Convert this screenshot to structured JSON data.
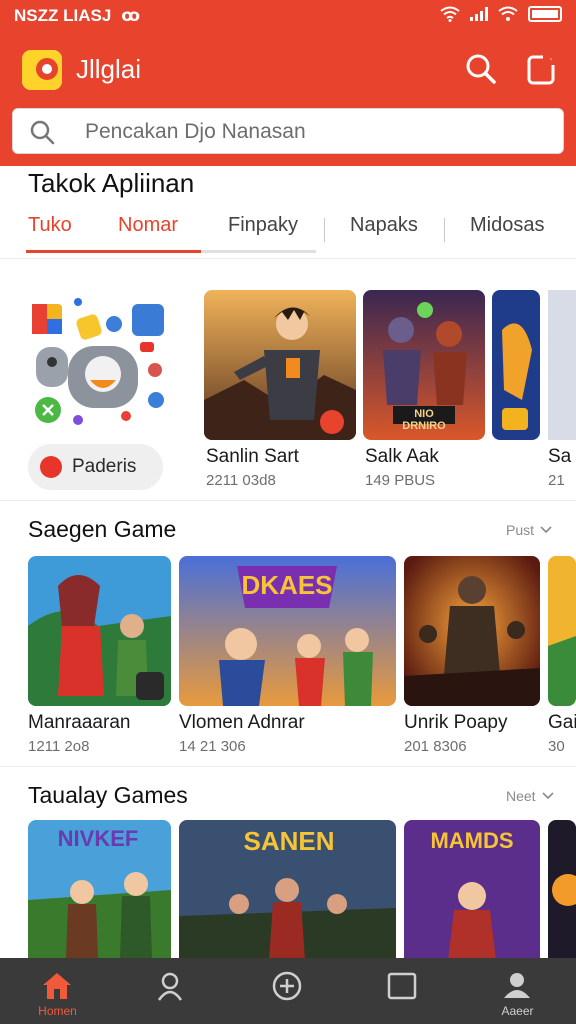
{
  "status": {
    "left_text": "NSZZ LIASJ",
    "carrier_glyph": "ꝏ"
  },
  "app": {
    "title": "Jllglai"
  },
  "search": {
    "placeholder": "Pencakan Djo Nanasan"
  },
  "section1": {
    "title": "Takok Apliinan",
    "tabs": [
      {
        "label": "Tuko"
      },
      {
        "label": "Nomar"
      },
      {
        "label": "Finpaky"
      },
      {
        "label": "Napaks"
      },
      {
        "label": "Midosas"
      }
    ],
    "featured_pill": "Paderis",
    "cards": [
      {
        "title": "Sanlin Sart",
        "sub": "2211 03d8"
      },
      {
        "title": "Salk Aak",
        "sub": "149 PBUS",
        "banner": "NIO DRNIRO"
      },
      {
        "title": "Sa",
        "sub": "21"
      }
    ]
  },
  "section2": {
    "title": "Saegen Game",
    "more": "Pust",
    "cards": [
      {
        "title": "Manraaaran",
        "sub": "1211 2o8"
      },
      {
        "title": "Vlomen Adnrar",
        "sub": "14 21 306",
        "banner": "DKAES"
      },
      {
        "title": "Unrik Poapy",
        "sub": "201 8306"
      },
      {
        "title": "Gai",
        "sub": "30"
      }
    ]
  },
  "section3": {
    "title": "Taualay Games",
    "more": "Neet",
    "cards": [
      {
        "banner": "NIVKEF"
      },
      {
        "banner": "SANEN"
      },
      {
        "banner": "MAMDS"
      }
    ]
  },
  "bottom_nav": [
    {
      "label": "Homen",
      "icon": "home-icon"
    },
    {
      "label": "",
      "icon": "profile-search-icon"
    },
    {
      "label": "",
      "icon": "add-circle-icon"
    },
    {
      "label": "",
      "icon": "library-icon"
    },
    {
      "label": "Aaeer",
      "icon": "account-icon"
    }
  ],
  "colors": {
    "brand": "#e8432c",
    "nav_bg": "#3a3a3a"
  }
}
